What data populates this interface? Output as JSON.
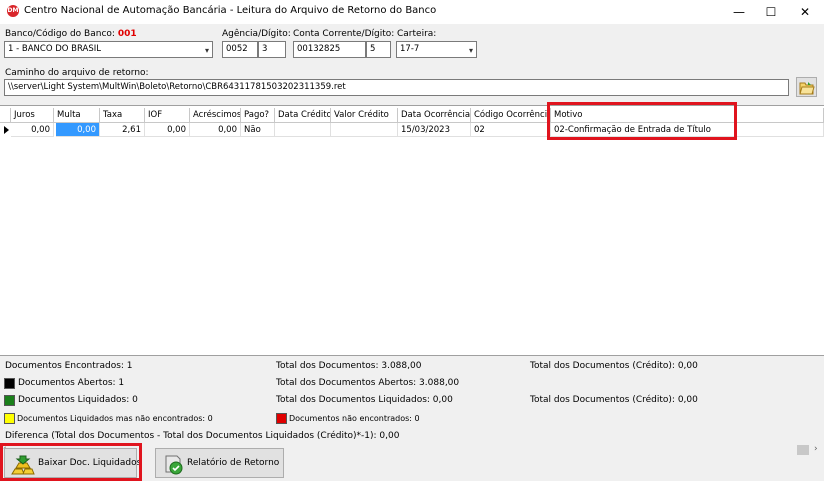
{
  "window": {
    "title": "Centro Nacional de Automação Bancária - Leitura do Arquivo de Retorno do Banco",
    "icon_text": "DM",
    "minimize": "—",
    "maximize": "☐",
    "close": "✕"
  },
  "form": {
    "bank_label": "Banco/Código do Banco:",
    "bank_code": "001",
    "bank_value": "1 - BANCO DO BRASIL",
    "agency_label": "Agência/Dígito:",
    "agency": "0052",
    "agency_digit": "3",
    "account_label": "Conta Corrente/Dígito:",
    "account": "00132825",
    "account_digit": "5",
    "wallet_label": "Carteira:",
    "wallet": "17-7",
    "path_label": "Caminho do arquivo de retorno:",
    "path": "\\\\server\\Light System\\MultWin\\Boleto\\Retorno\\CBR64311781503202311359.ret"
  },
  "grid": {
    "columns": [
      "Juros",
      "Multa",
      "Taxa",
      "IOF",
      "Acréscimos",
      "Pago?",
      "Data Crédito",
      "Valor Crédito",
      "Data Ocorrência",
      "Código Ocorrência",
      "Motivo"
    ],
    "row": [
      "0,00",
      "0,00",
      "2,61",
      "0,00",
      "0,00",
      "Não",
      "",
      "",
      "15/03/2023",
      "02",
      "02-Confirmação de Entrada de Título"
    ]
  },
  "summary": {
    "found": "Documentos Encontrados: 1",
    "total_docs": "Total dos Documentos: 3.088,00",
    "total_credit_1": "Total dos Documentos (Crédito): 0,00",
    "open": "Documentos Abertos: 1",
    "total_open": "Total dos Documentos Abertos: 3.088,00",
    "settled": "Documentos Liquidados: 0",
    "total_settled": "Total dos Documentos Liquidados: 0,00",
    "total_credit_2": "Total dos Documentos (Crédito): 0,00",
    "settled_not_found": "Documentos Liquidados mas não encontrados: 0",
    "not_found": "Documentos não encontrados: 0",
    "difference": "Diferenca (Total dos Documentos - Total dos Documentos Liquidados (Crédito)*-1): 0,00"
  },
  "colors": {
    "open": "#000000",
    "settled": "#1a7f1a",
    "settled_not_found": "#ffff00",
    "not_found": "#e00000",
    "highlight": "#e0141e"
  },
  "buttons": {
    "download": "Baixar Doc. Liquidados",
    "report": "Relatório de Retorno"
  },
  "icons": {
    "browse": "folder-open-icon",
    "download": "gold-bars-icon",
    "report": "check-report-icon"
  }
}
